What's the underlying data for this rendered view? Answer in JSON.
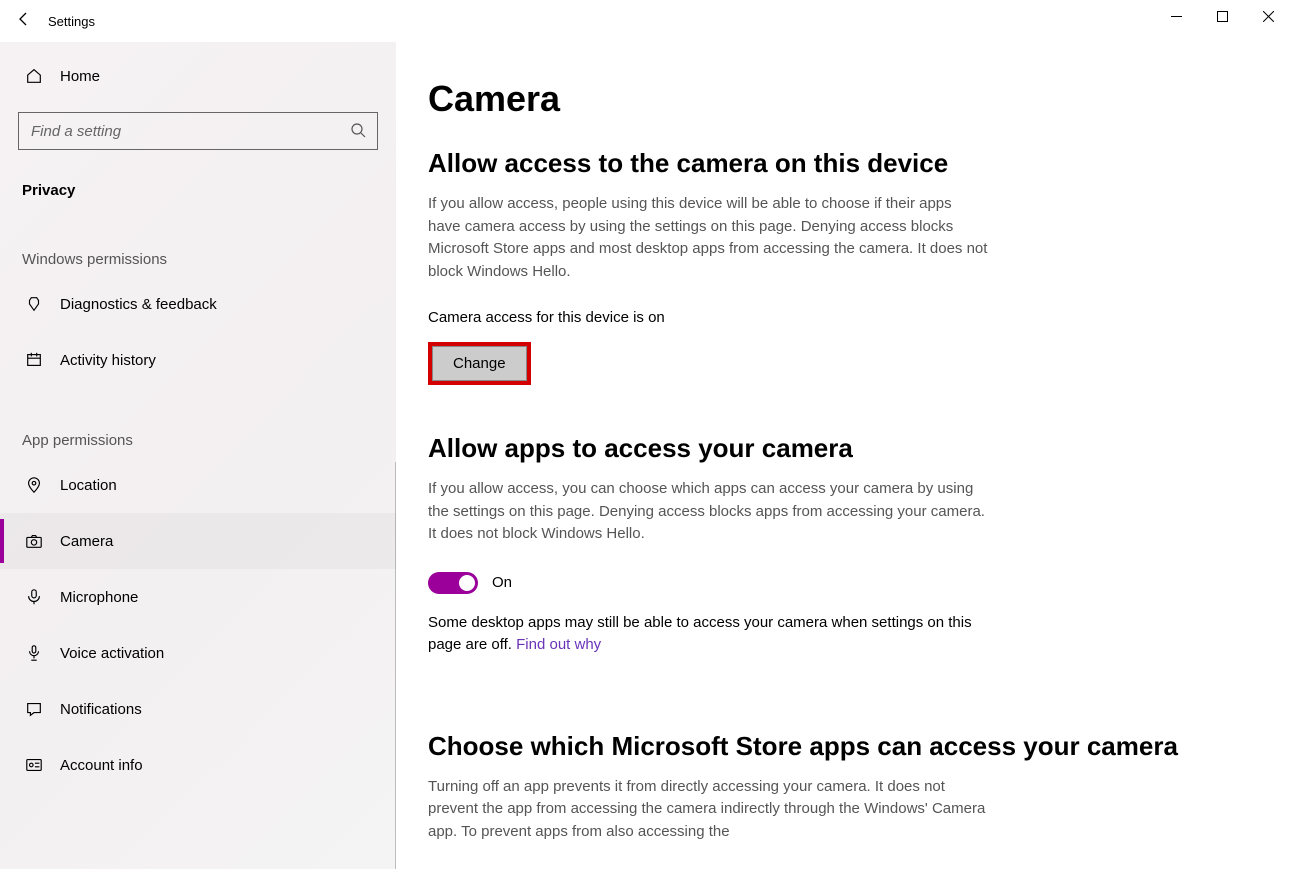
{
  "window": {
    "title": "Settings"
  },
  "sidebar": {
    "home": "Home",
    "search_placeholder": "Find a setting",
    "privacy_label": "Privacy",
    "cat_windows": "Windows permissions",
    "cat_app": "App permissions",
    "items_windows": [
      {
        "label": "Diagnostics & feedback"
      },
      {
        "label": "Activity history"
      }
    ],
    "items_app": [
      {
        "label": "Location"
      },
      {
        "label": "Camera"
      },
      {
        "label": "Microphone"
      },
      {
        "label": "Voice activation"
      },
      {
        "label": "Notifications"
      },
      {
        "label": "Account info"
      }
    ]
  },
  "main": {
    "page_title": "Camera",
    "section1_title": "Allow access to the camera on this device",
    "section1_desc": "If you allow access, people using this device will be able to choose if their apps have camera access by using the settings on this page. Denying access blocks Microsoft Store apps and most desktop apps from accessing the camera. It does not block Windows Hello.",
    "access_status": "Camera access for this device is on",
    "change_label": "Change",
    "section2_title": "Allow apps to access your camera",
    "section2_desc": "If you allow access, you can choose which apps can access your camera by using the settings on this page. Denying access blocks apps from accessing your camera. It does not block Windows Hello.",
    "toggle_state": "On",
    "desktop_note_prefix": "Some desktop apps may still be able to access your camera when settings on this page are off. ",
    "desktop_note_link": "Find out why",
    "section3_title": "Choose which Microsoft Store apps can access your camera",
    "section3_desc": "Turning off an app prevents it from directly accessing your camera. It does not prevent the app from accessing the camera indirectly through the Windows' Camera app. To prevent apps from also accessing the"
  }
}
